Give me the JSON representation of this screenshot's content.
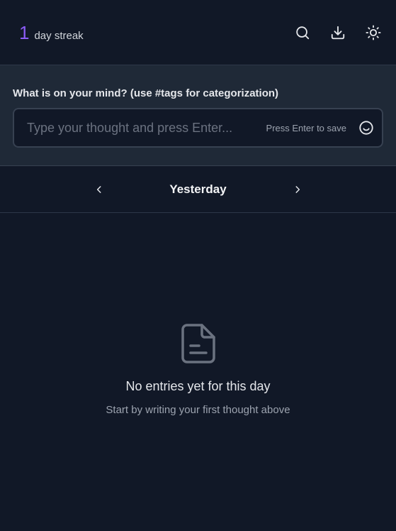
{
  "header": {
    "streak_count": "1",
    "streak_label": "day streak",
    "icons": [
      "search-icon",
      "download-icon",
      "sun-icon"
    ]
  },
  "entry": {
    "prompt": "What is on your mind? (use #tags for categorization)",
    "placeholder": "Type your thought and press Enter...",
    "value": "",
    "hint": "Press Enter to save",
    "emoji_icon": "smiley-icon"
  },
  "date_nav": {
    "label": "Yesterday",
    "prev_icon": "chevron-left-icon",
    "next_icon": "chevron-right-icon"
  },
  "empty_state": {
    "icon": "document-icon",
    "title": "No entries yet for this day",
    "subtitle": "Start by writing your first thought above"
  },
  "colors": {
    "background": "#111827",
    "panel": "#1f2937",
    "accent": "#8b5cf6",
    "muted": "#9ca3af"
  }
}
